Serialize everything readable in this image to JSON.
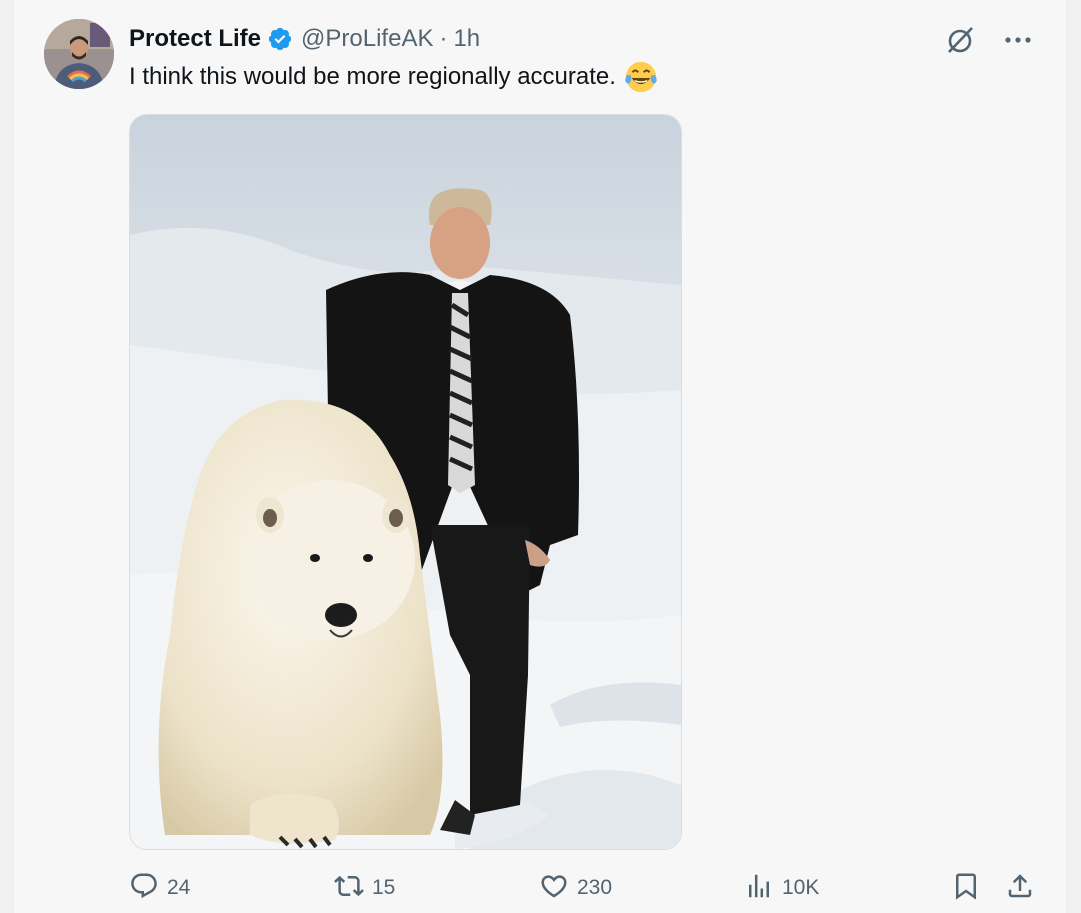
{
  "post": {
    "author": {
      "display_name": "Protect Life",
      "handle": "@ProLifeAK",
      "separator": "·",
      "time": "1h",
      "verified": true
    },
    "text": "I think this would be more regionally accurate.",
    "text_emoji": "face-with-tears-of-joy",
    "media_description_icon": "photo",
    "actions": {
      "replies": "24",
      "reposts": "15",
      "likes": "230",
      "views": "10K"
    },
    "icons": {
      "grok": "grok-icon",
      "more": "more-icon",
      "reply": "reply-icon",
      "repost": "repost-icon",
      "like": "heart-icon",
      "views": "views-icon",
      "bookmark": "bookmark-icon",
      "share": "share-icon"
    }
  },
  "colors": {
    "verified_blue": "#1d9bf0",
    "secondary_text": "#536471",
    "primary_text": "#0f1419"
  }
}
